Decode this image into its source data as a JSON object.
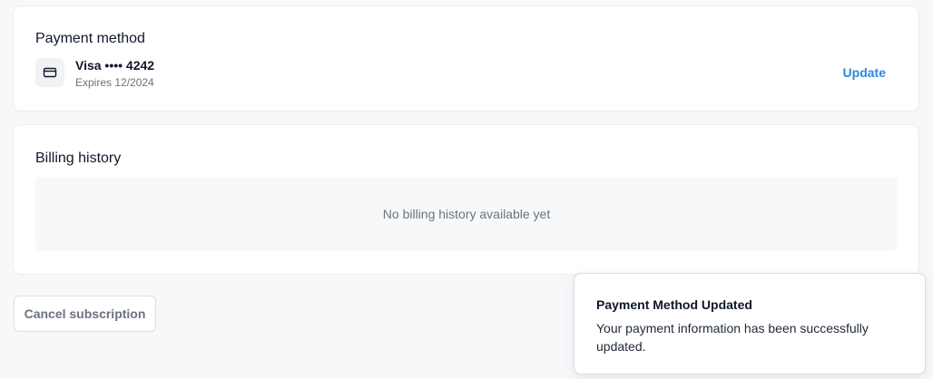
{
  "payment": {
    "title": "Payment method",
    "icon": "credit-card-icon",
    "card_brand_last4": "Visa •••• 4242",
    "expiry": "Expires 12/2024",
    "update_label": "Update",
    "accent_color": "#2f86de"
  },
  "billing": {
    "title": "Billing history",
    "empty_message": "No billing history available yet"
  },
  "actions": {
    "cancel_label": "Cancel subscription"
  },
  "toast": {
    "title": "Payment Method Updated",
    "message": "Your payment information has been successfully updated."
  }
}
